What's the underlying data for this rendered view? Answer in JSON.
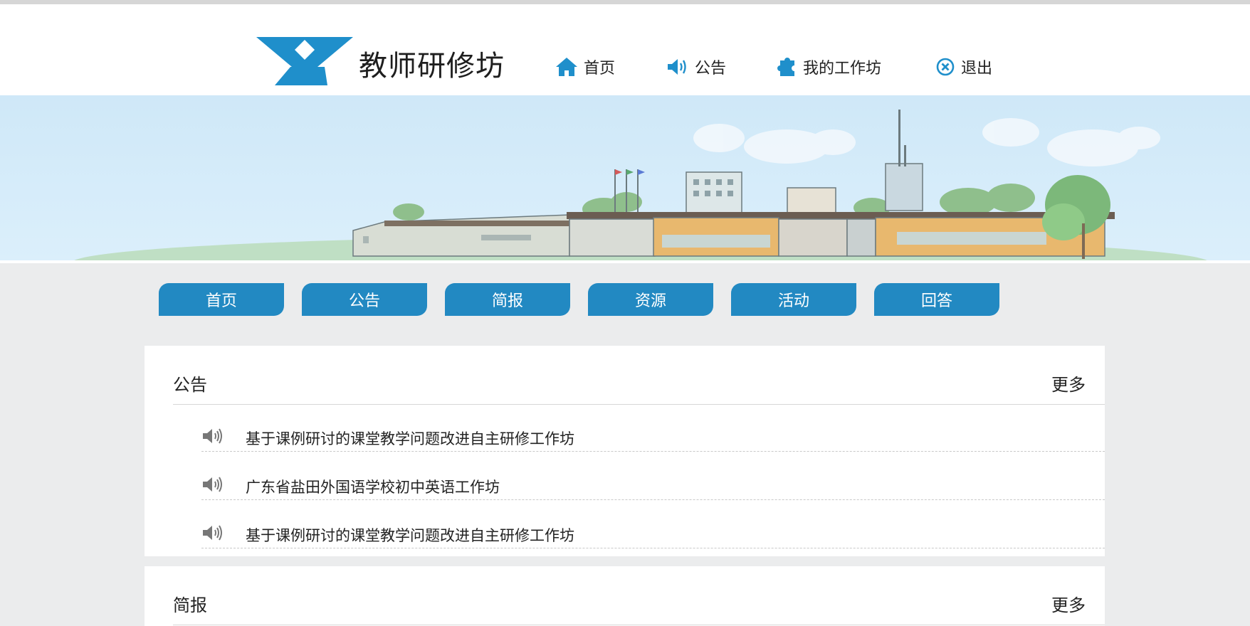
{
  "header": {
    "site_title": "教师研修坊",
    "nav": [
      {
        "label": "首页",
        "icon": "home-icon"
      },
      {
        "label": "公告",
        "icon": "speaker-icon"
      },
      {
        "label": "我的工作坊",
        "icon": "puzzle-icon"
      },
      {
        "label": "退出",
        "icon": "close-circle-icon"
      }
    ]
  },
  "banner": {
    "image": "campus-illustration"
  },
  "tabs": [
    {
      "label": "首页"
    },
    {
      "label": "公告"
    },
    {
      "label": "简报"
    },
    {
      "label": "资源"
    },
    {
      "label": "活动"
    },
    {
      "label": "回答"
    }
  ],
  "announcements": {
    "title": "公告",
    "more": "更多",
    "items": [
      {
        "text": "基于课例研讨的课堂教学问题改进自主研修工作坊"
      },
      {
        "text": "广东省盐田外国语学校初中英语工作坊"
      },
      {
        "text": "基于课例研讨的课堂教学问题改进自主研修工作坊"
      }
    ]
  },
  "briefings": {
    "title": "简报",
    "more": "更多"
  },
  "colors": {
    "accent": "#2289c2",
    "background": "#ebeced",
    "sky": "#cfe8f8"
  }
}
